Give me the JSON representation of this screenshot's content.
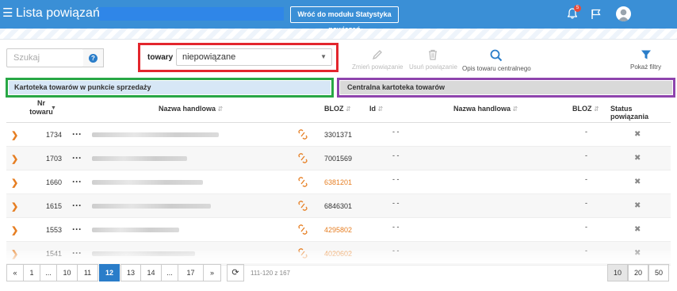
{
  "header": {
    "title": "Lista powiązań dla:",
    "back_button": "Wróć do modułu Statystyka powiązań",
    "notification_count": "5"
  },
  "toolbar": {
    "search_placeholder": "Szukaj",
    "filter_label": "towary",
    "filter_value": "niepowiązane",
    "change_link": "Zmień powiązanie",
    "remove_link": "Usuń powiązanie",
    "describe": "Opis towaru centralnego",
    "show_filters": "Pokaż filtry"
  },
  "sections": {
    "left": "Kartoteka towarów w punkcie sprzedaży",
    "right": "Centralna kartoteka towarów"
  },
  "columns": {
    "nr": "Nr towaru",
    "name": "Nazwa handlowa",
    "bloz": "BLOZ",
    "id": "Id",
    "name2": "Nazwa handlowa",
    "bloz2": "BLOZ",
    "status": "Status powiązania"
  },
  "rows": [
    {
      "nr": "1734",
      "bloz": "3301371",
      "orange": false,
      "d1": "- -",
      "d2": "-"
    },
    {
      "nr": "1703",
      "bloz": "7001569",
      "orange": false,
      "d1": "- -",
      "d2": "-"
    },
    {
      "nr": "1660",
      "bloz": "6381201",
      "orange": true,
      "d1": "- -",
      "d2": "-"
    },
    {
      "nr": "1615",
      "bloz": "6846301",
      "orange": false,
      "d1": "- -",
      "d2": "-"
    },
    {
      "nr": "1553",
      "bloz": "4295802",
      "orange": true,
      "d1": "- -",
      "d2": "-"
    },
    {
      "nr": "1541",
      "bloz": "4020602",
      "orange": true,
      "d1": "- -",
      "d2": "-"
    }
  ],
  "pagination": {
    "pages": [
      "«",
      "1",
      "...",
      "10",
      "11",
      "12",
      "13",
      "14",
      "...",
      "17",
      "»"
    ],
    "active": "12",
    "range": "111-120 z 167",
    "page_sizes": [
      "10",
      "20",
      "50"
    ],
    "page_size_active": "10"
  }
}
